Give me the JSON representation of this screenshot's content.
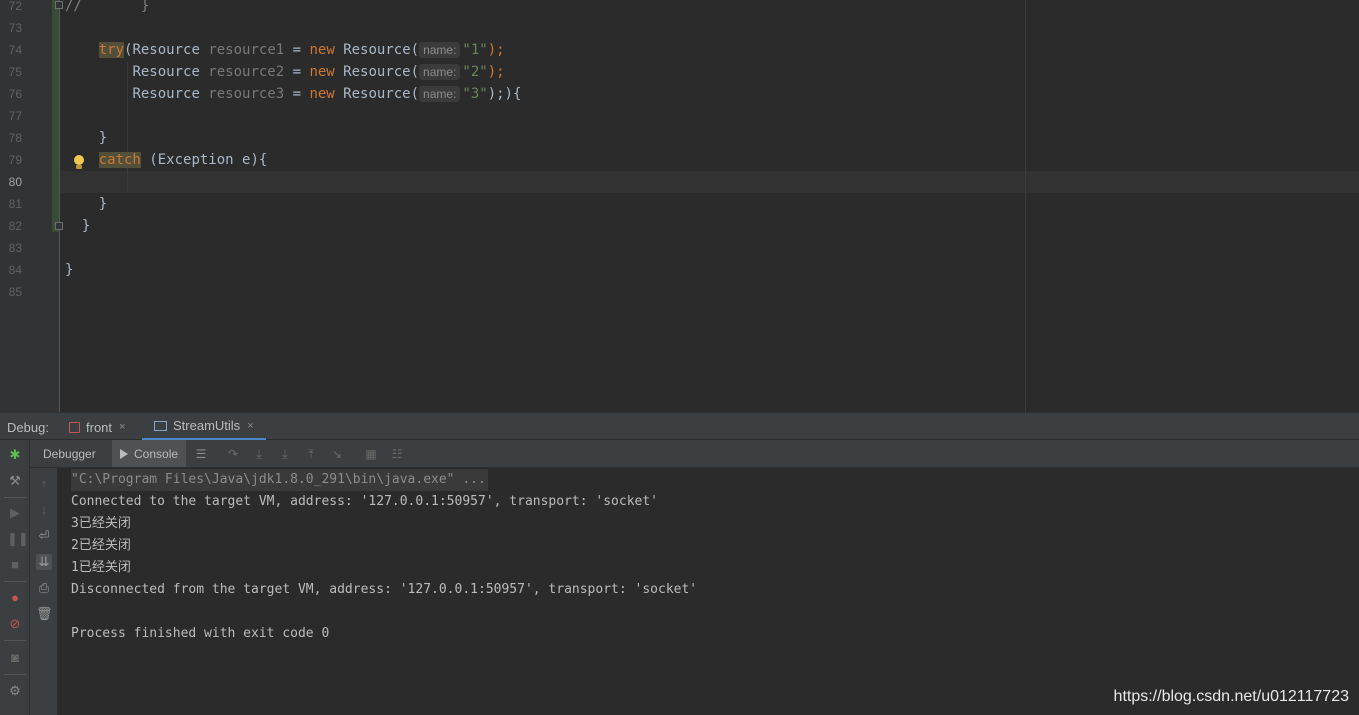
{
  "editor": {
    "line_numbers": [
      "72",
      "73",
      "74",
      "75",
      "76",
      "77",
      "78",
      "79",
      "80",
      "81",
      "82",
      "83",
      "84",
      "85"
    ],
    "current_line": "80",
    "lines": {
      "l72": {
        "cmt": "//",
        "rest": "       }"
      },
      "l74": {
        "kw_try": "try",
        "p1": "(Resource ",
        "var": "resource1",
        "p2": " = ",
        "kw_new": "new",
        "p3": " Resource(",
        "hint": "name:",
        "str": "\"1\"",
        "end": ");"
      },
      "l75": {
        "p1": "Resource ",
        "var": "resource2",
        "p2": " = ",
        "kw_new": "new",
        "p3": " Resource(",
        "hint": "name:",
        "str": "\"2\"",
        "end": ");"
      },
      "l76": {
        "p1": "Resource ",
        "var": "resource3",
        "p2": " = ",
        "kw_new": "new",
        "p3": " Resource(",
        "hint": "name:",
        "str": "\"3\"",
        "end": ");){"
      },
      "l78": {
        "text": "}"
      },
      "l79": {
        "kw_catch": "catch",
        "rest": " (Exception e){"
      },
      "l81": {
        "text": "}"
      },
      "l82": {
        "text": "}"
      },
      "l84": {
        "text": "}"
      }
    },
    "colors": {
      "keyword": "#cc7832",
      "string": "#6a8759",
      "identifier": "#a9b7c6",
      "unused_var": "#787878"
    }
  },
  "debug": {
    "label": "Debug:",
    "run_tabs": [
      {
        "label": "front",
        "close": "×"
      },
      {
        "label": "StreamUtils",
        "close": "×"
      }
    ],
    "sub_tabs": {
      "debugger": "Debugger",
      "console": "Console"
    },
    "toolbar_icons": [
      "menu-icon",
      "step-over-icon",
      "step-into-icon",
      "force-step-into-icon",
      "step-out-icon",
      "run-to-cursor-icon",
      "evaluate-icon",
      "trace-icon"
    ],
    "left_icons": [
      "bug-icon",
      "wrench-icon",
      "resume-icon",
      "pause-icon",
      "stop-icon",
      "view-breakpoints-icon",
      "mute-breakpoints-icon",
      "camera-icon",
      "settings-icon"
    ],
    "console_icons": [
      "up-arrow-icon",
      "down-arrow-icon",
      "soft-wrap-icon",
      "scroll-to-end-icon",
      "print-icon",
      "trash-icon"
    ]
  },
  "console": {
    "lines": [
      "\"C:\\Program Files\\Java\\jdk1.8.0_291\\bin\\java.exe\" ...",
      "Connected to the target VM, address: '127.0.0.1:50957', transport: 'socket'",
      "3已经关闭",
      "2已经关闭",
      "1已经关闭",
      "Disconnected from the target VM, address: '127.0.0.1:50957', transport: 'socket'",
      "",
      "Process finished with exit code 0"
    ]
  },
  "watermark": "https://blog.csdn.net/u012117723"
}
